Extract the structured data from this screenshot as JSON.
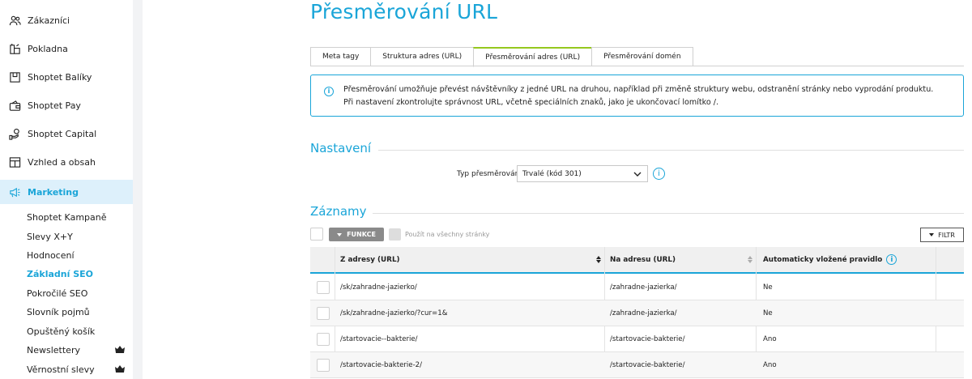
{
  "sidebar": {
    "items": [
      {
        "label": "Zákazníci",
        "icon": "users-icon"
      },
      {
        "label": "Pokladna",
        "icon": "cash-register-icon"
      },
      {
        "label": "Shoptet Balíky",
        "icon": "package-icon"
      },
      {
        "label": "Shoptet Pay",
        "icon": "wallet-icon"
      },
      {
        "label": "Shoptet Capital",
        "icon": "money-hand-icon"
      },
      {
        "label": "Vzhled a obsah",
        "icon": "layout-icon"
      },
      {
        "label": "Marketing",
        "icon": "megaphone-icon",
        "active": true
      }
    ],
    "sub_items": [
      {
        "label": "Shoptet Kampaně"
      },
      {
        "label": "Slevy X+Y"
      },
      {
        "label": "Hodnocení"
      },
      {
        "label": "Základní SEO",
        "active": true
      },
      {
        "label": "Pokročilé SEO"
      },
      {
        "label": "Slovník pojmů"
      },
      {
        "label": "Opuštěný košík"
      },
      {
        "label": "Newslettery",
        "icon": "crown-icon"
      },
      {
        "label": "Věrnostní slevy",
        "icon": "crown-icon"
      }
    ]
  },
  "page": {
    "title": "Přesměrování URL"
  },
  "tabs": [
    {
      "label": "Meta tagy"
    },
    {
      "label": "Struktura adres (URL)"
    },
    {
      "label": "Přesměrování adres (URL)",
      "active": true
    },
    {
      "label": "Přesměrování domén"
    }
  ],
  "info": {
    "line1": "Přesměrování umožňuje převést návštěvníky z jedné URL na druhou, například při změně struktury webu, odstranění stránky nebo vyprodání produktu.",
    "line2": "Při nastavení zkontrolujte správnost URL, včetně speciálních znaků, jako je ukončovací lomítko /."
  },
  "settings": {
    "title": "Nastavení",
    "type_label": "Typ přesměrování",
    "type_value": "Trvalé (kód 301)"
  },
  "records": {
    "title": "Záznamy",
    "funkce_label": "FUNKCE",
    "apply_label": "Použít na všechny stránky",
    "filter_label": "FILTR",
    "columns": [
      "Z adresy (URL)",
      "Na adresu (URL)",
      "Automaticky vložené pravidlo"
    ],
    "rows": [
      {
        "from": "/sk/zahradne-jazierko/",
        "to": "/zahradne-jazierka/",
        "auto": "Ne"
      },
      {
        "from": "/sk/zahradne-jazierko/?cur=1&",
        "to": "/zahradne-jazierka/",
        "auto": "Ne"
      },
      {
        "from": "/startovacie--bakterie/",
        "to": "/startovacie-bakterie/",
        "auto": "Ano"
      },
      {
        "from": "/startovacie-bakterie-2/",
        "to": "/startovacie-bakterie/",
        "auto": "Ano"
      }
    ]
  },
  "colors": {
    "accent": "#1aa5d8",
    "tab_active": "#95c81e"
  }
}
